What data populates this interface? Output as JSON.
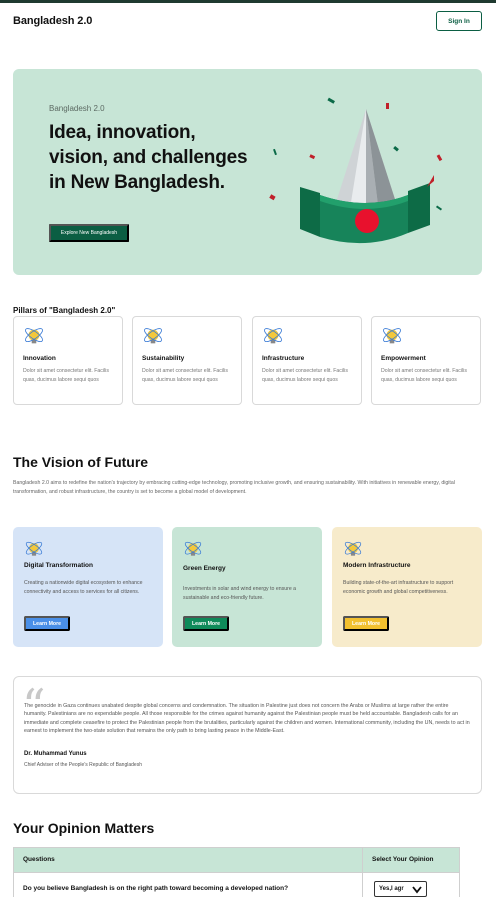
{
  "header": {
    "brand": "Bangladesh 2.0",
    "signin_label": "Sign In"
  },
  "hero": {
    "kicker": "Bangladesh 2.0",
    "title": "Idea, innovation, vision, and challenges in New Bangladesh.",
    "button_label": "Explore New Bangladesh"
  },
  "pillars": {
    "title": "Pillars of \"Bangladesh 2.0\"",
    "items": [
      {
        "title": "Innovation",
        "desc": "Dolor sit amet consectetur elit. Facilis quas, ducimus labore sequi quos"
      },
      {
        "title": "Sustainability",
        "desc": "Dolor sit amet consectetur elit. Facilis quas, ducimus labore sequi quos"
      },
      {
        "title": "Infrastructure",
        "desc": "Dolor sit amet consectetur elit. Facilis quas, ducimus labore sequi quos"
      },
      {
        "title": "Empowerment",
        "desc": "Dolor sit amet consectetur elit. Facilis quas, ducimus labore sequi quos"
      }
    ]
  },
  "vision": {
    "title": "The Vision of Future",
    "text": "Bangladesh 2.0 aims to redefine the nation's trajectory by embracing cutting-edge technology, promoting inclusive growth, and ensuring sustainability. With initiatives in renewable energy, digital transformation, and robust infrastructure, the country is set to become a global model of development.",
    "cards": [
      {
        "title": "Digital Transformation",
        "desc": "Creating a nationwide digital ecosystem to enhance connectivity and access to services for all citizens.",
        "button": "Learn More",
        "bg": "#d6e4f7",
        "btn_color": "#4a8fe7"
      },
      {
        "title": "Green Energy",
        "desc": "Investments in solar and wind energy to ensure a sustainable and eco-friendly future.",
        "button": "Learn More",
        "bg": "#c7e5d6",
        "btn_color": "#0f8a5a"
      },
      {
        "title": "Modern Infrastructure",
        "desc": "Building state-of-the-art infrastructure to support economic growth and global competitiveness.",
        "button": "Learn More",
        "bg": "#f7ebcb",
        "btn_color": "#f2c02f"
      }
    ]
  },
  "quote": {
    "text": "The genocide in Gaza continues unabated despite global concerns and condemnation. The situation in Palestine just does not concern the Arabs or Muslims at large rather the entire humanity. Palestinians are no expendable people. All those responsible for the crimes against humanity against the Palestinian people must be held accountable. Bangladesh calls for an immediate and complete ceasefire to protect the Palestinian people from the brutalities, particularly against the children and women. International community, including the UN, needs to act in earnest to implement the two-state solution that remains the only path to bring lasting peace in the Middle-East.",
    "author": "Dr. Muhammad Yunus",
    "role": "Chief Adviser of the People's Republic of Bangladesh"
  },
  "opinion": {
    "title": "Your Opinion Matters",
    "col_questions": "Questions",
    "col_select": "Select Your Opinion",
    "question": "Do you believe Bangladesh is on the right path toward becoming a developed nation?",
    "selected": "Yes,I agr"
  },
  "colors": {
    "brand_green": "#0b5e43",
    "hero_bg": "#c7e5d6",
    "flag_red": "#e8112d"
  }
}
